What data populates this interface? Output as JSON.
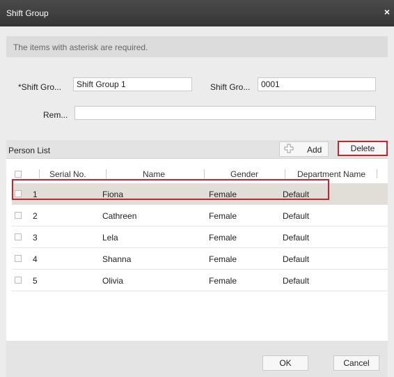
{
  "window": {
    "title": "Shift Group",
    "close_glyph": "×"
  },
  "notice": "The items with asterisk are required.",
  "form": {
    "name_label": "*Shift Gro...",
    "name_value": "Shift Group 1",
    "no_label": "Shift Gro...",
    "no_value": "0001",
    "remark_label": "Rem...",
    "remark_value": ""
  },
  "person_list": {
    "title": "Person List",
    "add_label": "Add",
    "add_icon": "plus-icon",
    "delete_label": "Delete",
    "columns": [
      "Serial No.",
      "Name",
      "Gender",
      "Department Name"
    ],
    "rows": [
      {
        "serial": "1",
        "name": "Fiona",
        "gender": "Female",
        "department": "Default",
        "selected": true
      },
      {
        "serial": "2",
        "name": "Cathreen",
        "gender": "Female",
        "department": "Default",
        "selected": false
      },
      {
        "serial": "3",
        "name": "Lela",
        "gender": "Female",
        "department": "Default",
        "selected": false
      },
      {
        "serial": "4",
        "name": "Shanna",
        "gender": "Female",
        "department": "Default",
        "selected": false
      },
      {
        "serial": "5",
        "name": "Olivia",
        "gender": "Female",
        "department": "Default",
        "selected": false
      }
    ]
  },
  "footer": {
    "ok_label": "OK",
    "cancel_label": "Cancel"
  },
  "colors": {
    "highlight": "#d0202a",
    "titlebar": "#3c3c3c",
    "selected_row": "#e1ddd7"
  }
}
